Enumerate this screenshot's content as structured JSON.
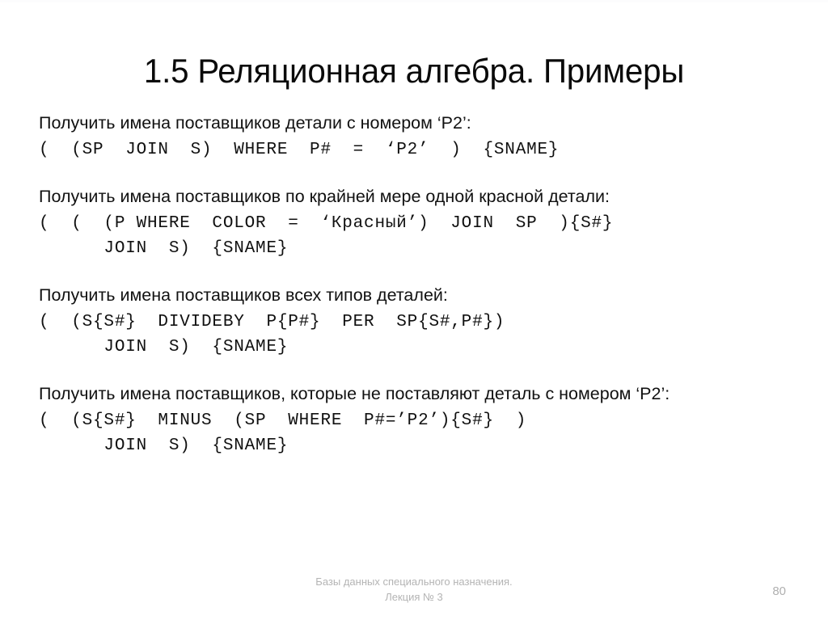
{
  "slide": {
    "title": "1.5 Реляционная алгебра. Примеры",
    "page_number": "80",
    "text_color": "#111111",
    "footer_color": "#b4b4b4",
    "background_color": "#ffffff"
  },
  "examples": [
    {
      "prose": "Получить имена поставщиков детали с номером ‘P2’:",
      "code": [
        "(  (SP  JOIN  S)  WHERE  P#  =  ‘P2’  )  {SNAME}"
      ]
    },
    {
      "prose": "Получить имена поставщиков по крайней мере одной красной детали:",
      "code": [
        "(  (  (P WHERE  COLOR  =  ‘Красный’)  JOIN  SP  ){S#}",
        "      JOIN  S)  {SNAME}"
      ]
    },
    {
      "prose": "Получить имена поставщиков всех типов деталей:",
      "code": [
        "(  (S{S#}  DIVIDEBY  P{P#}  PER  SP{S#,P#})",
        "      JOIN  S)  {SNAME}"
      ]
    },
    {
      "prose": "Получить имена поставщиков, которые не поставляют деталь с номером ‘P2’:",
      "code": [
        "(  (S{S#}  MINUS  (SP  WHERE  P#=’P2’){S#}  )",
        "      JOIN  S)  {SNAME}"
      ]
    }
  ],
  "footer": {
    "line1": "Базы данных специального назначения.",
    "line2": "Лекция № 3"
  }
}
